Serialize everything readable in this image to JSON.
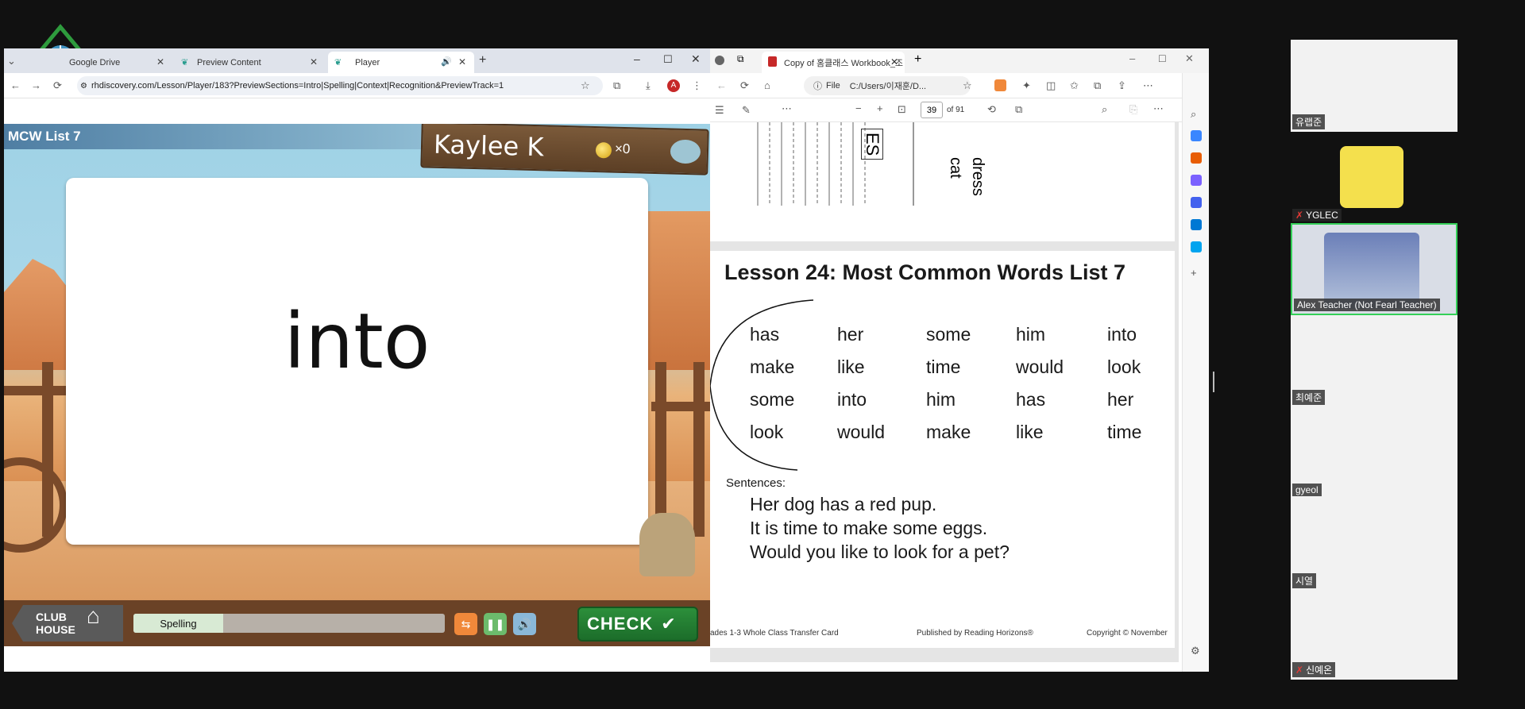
{
  "left_browser": {
    "tabs": [
      {
        "label": "Google Drive"
      },
      {
        "label": "Preview Content"
      },
      {
        "label": "Player"
      }
    ],
    "url": "rhdiscovery.com/Lesson/Player/183?PreviewSections=Intro|Spelling|Context|Recognition&PreviewTrack=1"
  },
  "game": {
    "list_title": "MCW List 7",
    "student_name": "Kaylee K",
    "coins": "×0",
    "word": "into",
    "clubhouse_line1": "CLUB",
    "clubhouse_line2": "HOUSE",
    "section_label": "Spelling",
    "check_label": "CHECK",
    "check_glyph": "✔"
  },
  "pdf_browser": {
    "tab_title": "Copy of 홈클래스 Workbook_조",
    "file_label": "File",
    "url": "C:/Users/이재훈/D...",
    "page_number": "39",
    "page_total": "of 91",
    "lesson_title": "Lesson 24: Most Common Words List 7",
    "word_rows": [
      [
        "has",
        "her",
        "some",
        "him",
        "into"
      ],
      [
        "make",
        "like",
        "time",
        "would",
        "look"
      ],
      [
        "some",
        "into",
        "him",
        "has",
        "her"
      ],
      [
        "look",
        "would",
        "make",
        "like",
        "time"
      ]
    ],
    "sentences_label": "Sentences:",
    "sentences": [
      "Her dog has a red pup.",
      "It is time to make some eggs.",
      "Would you like to look for a pet?"
    ],
    "footer_left": "ades 1-3 Whole Class Transfer Card",
    "footer_mid": "Published by Reading Horizons®",
    "footer_right": "Copyright © November",
    "prev_page_words": [
      "dress",
      "cat"
    ],
    "prev_page_box": "ES"
  },
  "participants": [
    {
      "name": "유랩준",
      "muted": false
    },
    {
      "name": "YGLEC",
      "muted": true
    },
    {
      "name": "Alex Teacher (Not Fearl Teacher)",
      "muted": false,
      "active": true
    },
    {
      "name": "최예준",
      "muted": false
    },
    {
      "name": "gyeol",
      "muted": false
    },
    {
      "name": "시열",
      "muted": false
    },
    {
      "name": "신예온",
      "muted": true
    }
  ],
  "colors": {
    "active_speaker": "#34d058",
    "check_green": "#1c6d2a",
    "orange_btn": "#f0883a",
    "green_btn": "#6cbb6c",
    "blue_btn": "#8ab8d8"
  }
}
